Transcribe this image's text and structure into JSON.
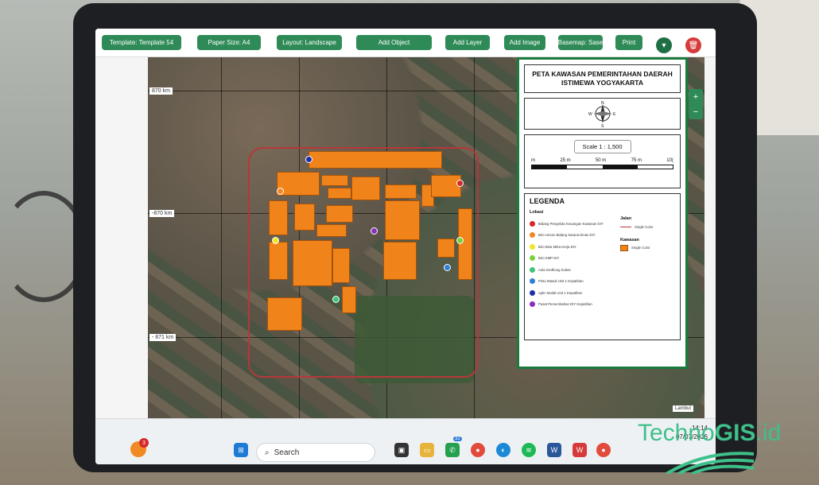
{
  "toolbar": {
    "buttons": [
      {
        "label": "Template: Template 54"
      },
      {
        "label": "Paper Size: A4"
      },
      {
        "label": "Layout: Landscape"
      },
      {
        "label": "Add Object"
      },
      {
        "label": "Add Layer"
      },
      {
        "label": "Add Image"
      },
      {
        "label": "Basemap: Sase"
      },
      {
        "label": "Print"
      }
    ],
    "icons": [
      "download-icon",
      "delete-icon"
    ]
  },
  "map": {
    "grid_labels": [
      "870 km",
      "-870 km",
      "- 871 km"
    ],
    "zoom_in": "+",
    "zoom_out": "−",
    "attribution": "Lambut"
  },
  "panel": {
    "title": "PETA KAWASAN PEMERINTAHAN DAERAH ISTIMEWA YOGYAKARTA",
    "north": {
      "n": "N",
      "s": "S",
      "w": "W",
      "e": "E"
    },
    "scale": {
      "label": "Scale 1 : 1,500",
      "ticks": [
        "m",
        "25 m",
        "50 m",
        "75 m",
        "10("
      ]
    },
    "legend": {
      "title": "LEGENDA",
      "lokasi_title": "Lokasi",
      "jalan_title": "Jalan",
      "jalan_item": "Single Color",
      "kawasan_title": "Kawasan",
      "kawasan_item": "Single Color",
      "items": [
        {
          "label": "Bidang Pengelola Keuangan Kawasan DIY",
          "color": "#d62828"
        },
        {
          "label": "Biro Umum Bidang Sarana Dinas DIY",
          "color": "#f08a24"
        },
        {
          "label": "Biro Bina Mitra Kerja DIY",
          "color": "#f2e529"
        },
        {
          "label": "Biro KMP DIY",
          "color": "#7bd13d"
        },
        {
          "label": "Aula Gedhong Sultan",
          "color": "#3fc47a"
        },
        {
          "label": "Pintu Masuk Unit 1 Kepatihan",
          "color": "#2f7fd6"
        },
        {
          "label": "Aplic Modal Unit 1 Kepatihan",
          "color": "#1d2fa8"
        },
        {
          "label": "Pusat Pemerintahan DIY Kepatihan",
          "color": "#8a2fc2"
        }
      ]
    }
  },
  "taskbar": {
    "search_placeholder": "Search",
    "notification_badge": "3",
    "whatsapp_badge": "32",
    "time": "14:14",
    "date": "07/07/2026"
  },
  "brand": {
    "part1": "Techno",
    "part2": "GIS",
    "part3": ".id"
  },
  "colors": {
    "accent": "#2e8b57",
    "building": "#f0841a",
    "boundary": "#b8363a"
  }
}
